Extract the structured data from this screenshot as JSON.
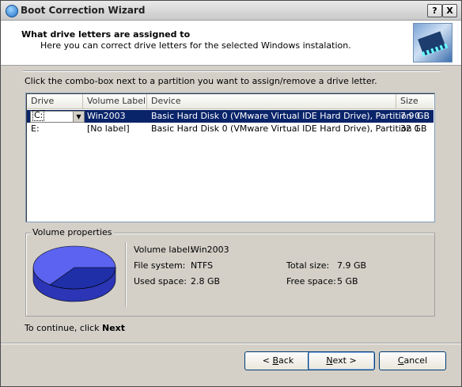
{
  "window": {
    "title": "Boot Correction Wizard",
    "help_btn": "?",
    "close_btn": "X"
  },
  "header": {
    "title": "What drive letters are assigned to",
    "subtitle": "Here you can correct drive letters for the selected Windows instalation."
  },
  "instruction": "Click the combo-box next to a partition you want to assign/remove a drive letter.",
  "list": {
    "columns": [
      "Drive Letter",
      "Volume Label",
      "Device",
      "Size"
    ],
    "rows": [
      {
        "drive": "C:",
        "label": "Win2003",
        "device": "Basic Hard Disk 0 (VMware Virtual IDE Hard Drive), Partition 0",
        "size": "7.9 GB",
        "selected": true
      },
      {
        "drive": "E:",
        "label": "[No label]",
        "device": "Basic Hard Disk 0 (VMware Virtual IDE Hard Drive), Partition 1",
        "size": "32 GB",
        "selected": false
      }
    ]
  },
  "volume_properties": {
    "title": "Volume properties",
    "volume_label_key": "Volume label:",
    "volume_label_val": "Win2003",
    "file_system_key": "File system:",
    "file_system_val": "NTFS",
    "used_space_key": "Used space:",
    "used_space_val": "2.8 GB",
    "total_size_key": "Total size:",
    "total_size_val": "7.9 GB",
    "free_space_key": "Free space:",
    "free_space_val": "5 GB",
    "used_fraction": 0.35,
    "colors": {
      "free": "#5b63f0",
      "used": "#1f2fa8"
    }
  },
  "footer": {
    "continue_prefix": "To continue, click ",
    "continue_bold": "Next",
    "back_arrow": "< ",
    "back_key": "B",
    "back_rest": "ack",
    "next_key": "N",
    "next_rest": "ext",
    "next_arrow": " >",
    "cancel_key": "C",
    "cancel_rest": "ancel"
  }
}
